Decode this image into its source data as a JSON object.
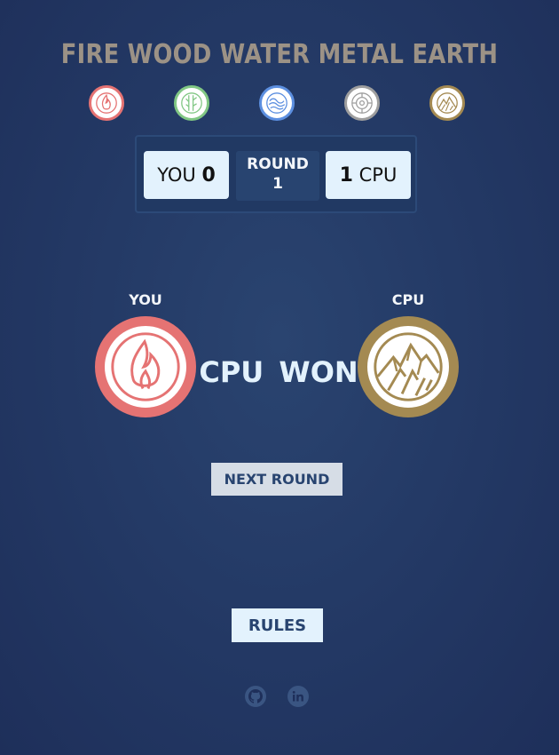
{
  "title": "FIRE WOOD WATER METAL EARTH",
  "elements": [
    {
      "name": "fire",
      "icon": "fire-icon",
      "color": "#e57373"
    },
    {
      "name": "wood",
      "icon": "wood-icon",
      "color": "#81c784"
    },
    {
      "name": "water",
      "icon": "water-icon",
      "color": "#5c8fe0"
    },
    {
      "name": "metal",
      "icon": "metal-icon",
      "color": "#9e9e9e"
    },
    {
      "name": "earth",
      "icon": "earth-icon",
      "color": "#a48a52"
    }
  ],
  "scoreboard": {
    "player_label": "YOU",
    "player_score": "0",
    "round_label": "ROUND",
    "round_number": "1",
    "cpu_score": "1",
    "cpu_label": "CPU"
  },
  "battle": {
    "player_label": "YOU",
    "player_choice": "fire",
    "cpu_label": "CPU",
    "cpu_choice": "earth",
    "result": "CPU WON"
  },
  "buttons": {
    "next_round": "NEXT ROUND",
    "rules": "RULES"
  },
  "footer": {
    "links": [
      {
        "name": "github",
        "icon": "github-icon"
      },
      {
        "name": "linkedin",
        "icon": "linkedin-icon"
      }
    ]
  }
}
